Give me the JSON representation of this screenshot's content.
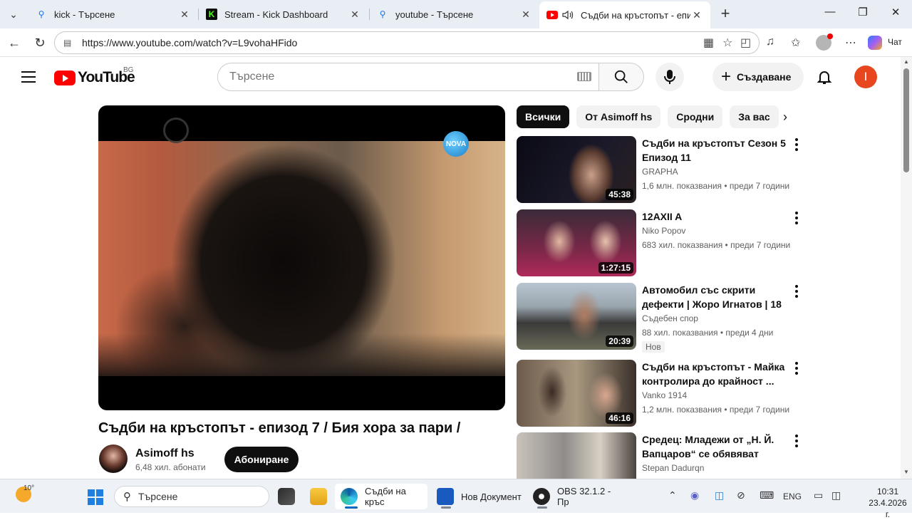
{
  "browser": {
    "tabs": [
      {
        "label": "kick - Търсене",
        "icon": "search-icon"
      },
      {
        "label": "Stream - Kick Dashboard",
        "icon": "kick-icon"
      },
      {
        "label": "youtube - Търсене",
        "icon": "search-icon"
      },
      {
        "label": "Съдби на кръстопът - епизод",
        "icon": "youtube-icon",
        "active": true
      }
    ],
    "url": "https://www.youtube.com/watch?v=L9vohaHFido",
    "copilot_label": "Чат"
  },
  "youtube": {
    "logo_text": "YouTube",
    "region": "BG",
    "search_placeholder": "Търсене",
    "create_label": "Създаване",
    "avatar_letter": "I",
    "video": {
      "watermark": "NOVA",
      "title": "Съдби на кръстопът - епизод 7 / Бия хора за пари /",
      "channel": "Asimoff hs",
      "subscribers": "6,48 хил. абонати",
      "subscribe_label": "Абониране"
    },
    "chips": [
      {
        "label": "Всички",
        "active": true
      },
      {
        "label": "От Asimoff hs",
        "active": false
      },
      {
        "label": "Сродни",
        "active": false
      },
      {
        "label": "За вас",
        "active": false
      }
    ],
    "recommendations": [
      {
        "title": "Съдби на кръстопът Сезон 5 Епизод 11",
        "channel": "GRAPHA",
        "meta": "1,6 млн. показвания • преди 7 години",
        "duration": "45:38"
      },
      {
        "title": "12AXII A",
        "channel": "Niko Popov",
        "meta": "683 хил. показвания • преди 7 години",
        "duration": "1:27:15"
      },
      {
        "title": "Автомобил със скрити дефекти | Жоро Игнатов | 18 ...",
        "channel": "Съдебен спор",
        "meta": "88 хил. показвания • преди 4 дни",
        "duration": "20:39",
        "badge": "Нов"
      },
      {
        "title": "Съдби на кръстопът - Майка контролира до крайност ...",
        "channel": "Vanko 1914",
        "meta": "1,2 млн. показвания • преди 7 години",
        "duration": "46:16"
      },
      {
        "title": "Средец: Младежи от „Н. Й. Вапцаров“ се обявяват срещ...",
        "channel": "Stepan Dadurqn",
        "meta": "",
        "duration": ""
      }
    ]
  },
  "taskbar": {
    "temperature": "10°",
    "search_label": "Търсене",
    "apps": [
      {
        "label": "Съдби на кръс",
        "icon": "edge-icon",
        "active": true
      },
      {
        "label": "Нов Документ",
        "icon": "word-icon",
        "active": false
      },
      {
        "label": "OBS 32.1.2 - Пр",
        "icon": "obs-icon",
        "active": false
      }
    ],
    "language": "ENG",
    "time": "10:31",
    "date": "23.4.2026 г."
  }
}
